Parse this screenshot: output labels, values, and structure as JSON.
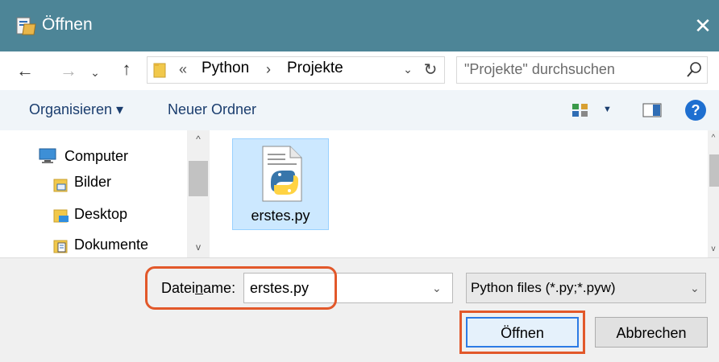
{
  "window": {
    "title": "Öffnen",
    "close_glyph": "✕"
  },
  "nav": {
    "back_glyph": "←",
    "forward_glyph": "→",
    "recent_glyph": "⌄",
    "up_glyph": "↑",
    "breadcrumb_overflow": "«",
    "breadcrumb": [
      "Python",
      "Projekte"
    ],
    "breadcrumb_separator": "›",
    "dropdown_glyph": "⌄",
    "refresh_glyph": "↻"
  },
  "search": {
    "placeholder": "\"Projekte\" durchsuchen",
    "icon": "search-icon"
  },
  "toolbar": {
    "organize_label": "Organisieren ▾",
    "new_folder_label": "Neuer Ordner",
    "views_dropdown_glyph": "▼",
    "help_label": "?"
  },
  "sidebar": {
    "items": [
      {
        "label": "Computer",
        "icon": "computer-icon"
      },
      {
        "label": "Bilder",
        "icon": "pictures-folder-icon"
      },
      {
        "label": "Desktop",
        "icon": "desktop-folder-icon"
      },
      {
        "label": "Dokumente",
        "icon": "documents-folder-icon"
      }
    ],
    "scroll_up_glyph": "^",
    "scroll_down_glyph": "v"
  },
  "files": [
    {
      "name": "erstes.py",
      "icon": "python-file-icon",
      "selected": true
    }
  ],
  "bottom": {
    "filename_label_pre": "Datei",
    "filename_label_underlined": "n",
    "filename_label_post": "ame:",
    "filename_value": "erstes.py",
    "filetype_value": "Python files (*.py;*.pyw)",
    "open_label": "Öffnen",
    "cancel_label": "Abbrechen",
    "dropdown_glyph": "⌄"
  },
  "colors": {
    "titlebar": "#4d8597",
    "toolbar": "#f0f5f9",
    "selection": "#cce8ff",
    "highlight": "#e2582a",
    "accent": "#2c7be5"
  }
}
